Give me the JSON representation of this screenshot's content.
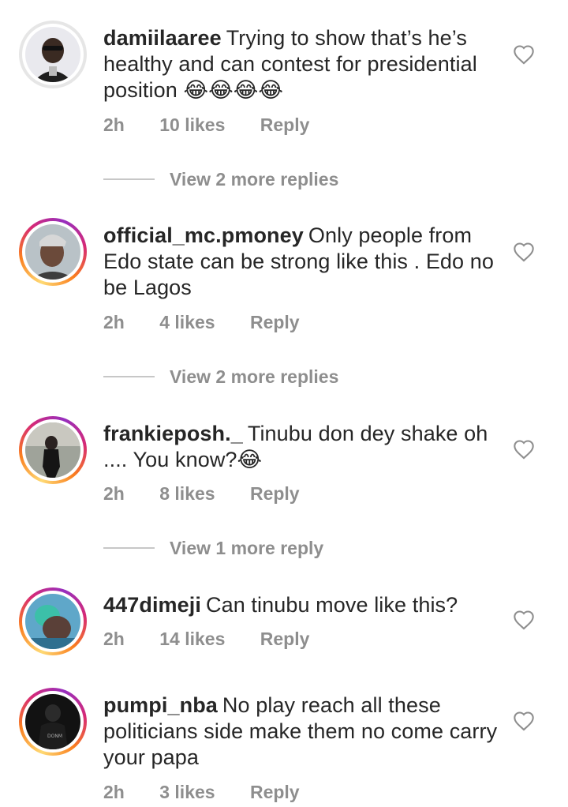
{
  "comments": [
    {
      "username": "damiilaaree",
      "text": "Trying to show that’s he’s healthy and can contest for presidential position 😂😂😂😂",
      "time": "2h",
      "likes": "10 likes",
      "reply": "Reply",
      "view_more": "View 2 more replies"
    },
    {
      "username": "official_mc.pmoney",
      "text": "Only people from Edo state can be strong like this . Edo no be Lagos",
      "time": "2h",
      "likes": "4 likes",
      "reply": "Reply",
      "view_more": "View 2 more replies"
    },
    {
      "username": "frankieposh._",
      "text": "Tinubu don dey shake oh .... You know?😂",
      "time": "2h",
      "likes": "8 likes",
      "reply": "Reply",
      "view_more": "View 1 more reply"
    },
    {
      "username": "447dimeji",
      "text": "Can tinubu move like this?",
      "time": "2h",
      "likes": "14 likes",
      "reply": "Reply"
    },
    {
      "username": "pumpi_nba",
      "text": "No play reach all these politicians side make them no come carry your papa",
      "time": "2h",
      "likes": "3 likes",
      "reply": "Reply"
    }
  ],
  "icons": {
    "like": "heart-outline-icon"
  },
  "colors": {
    "text": "#262626",
    "muted": "#8e8e8e",
    "divider": "#c7c7c7"
  }
}
